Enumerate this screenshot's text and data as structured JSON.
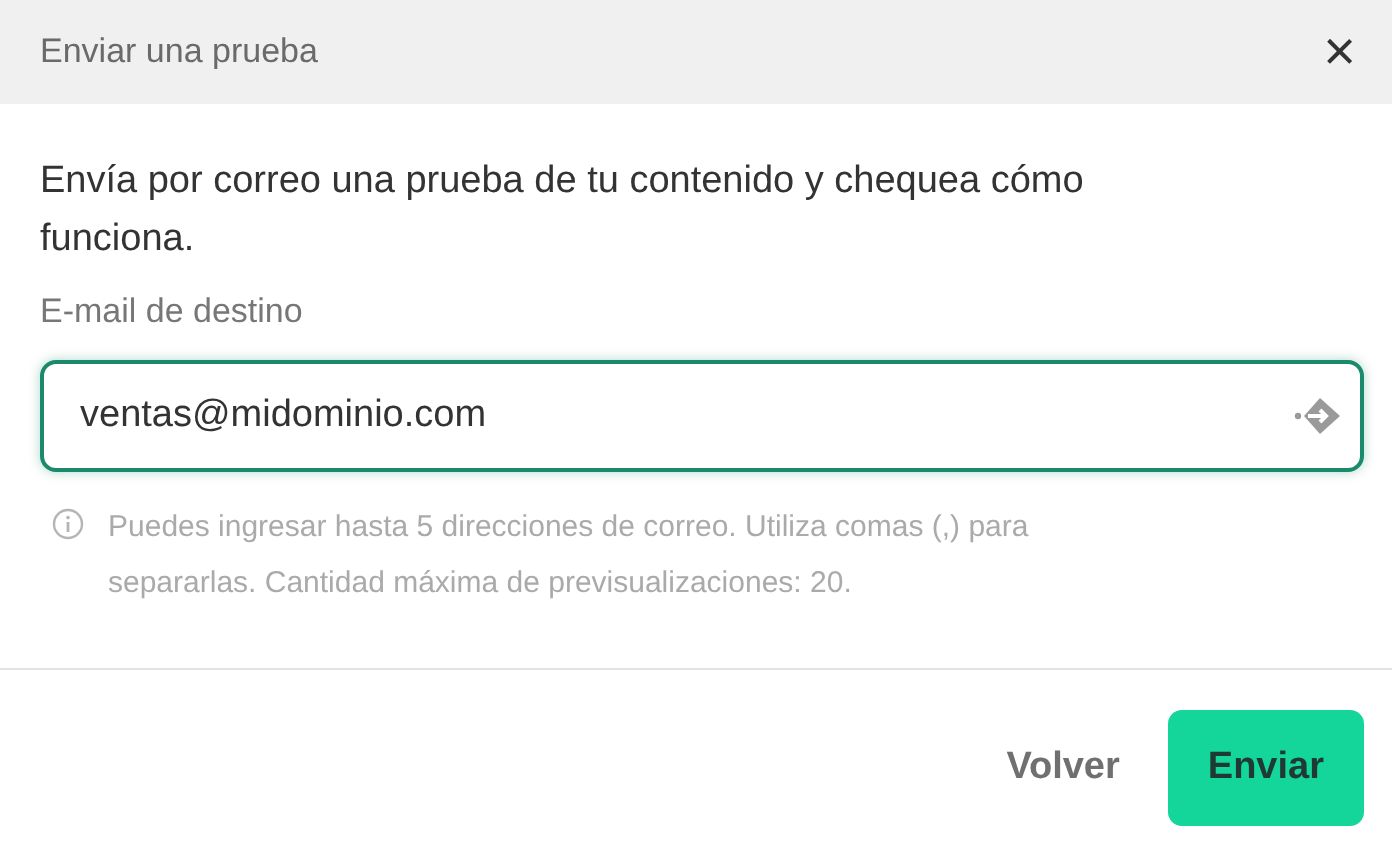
{
  "dialog": {
    "title": "Enviar una prueba",
    "close": "×"
  },
  "description": "Envía por correo una prueba de tu contenido y chequea cómo funciona.",
  "email_field": {
    "label": "E-mail de destino",
    "value": "ventas@midominio.com",
    "focused": true
  },
  "hint": "Puedes ingresar hasta 5 direcciones de correo. Utiliza comas (,) para separarlas. Cantidad máxima de previsualizaciones: 20.",
  "buttons": [
    {
      "label": "Volver",
      "kind": "secondary"
    },
    {
      "label": "Enviar",
      "kind": "primary"
    }
  ]
}
